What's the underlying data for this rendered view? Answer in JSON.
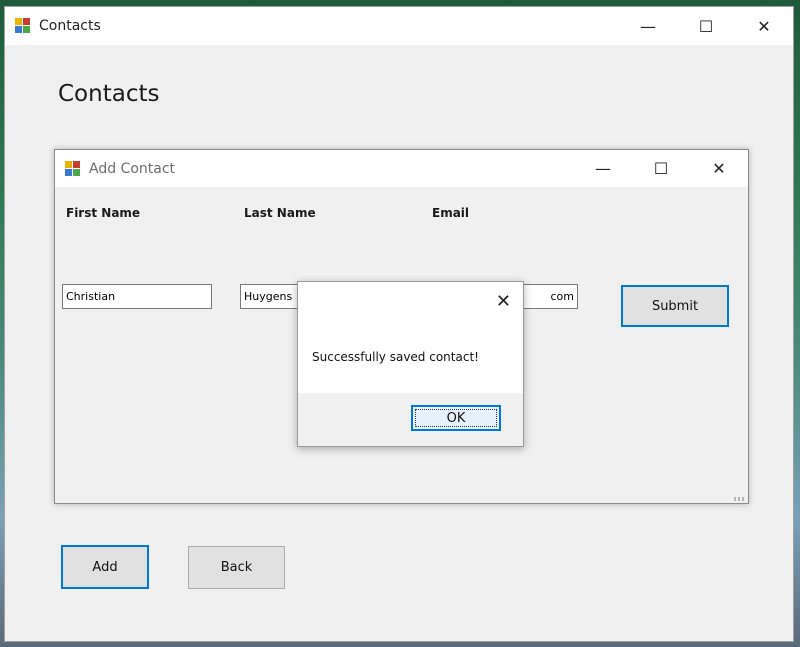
{
  "main": {
    "title": "Contacts",
    "heading": "Contacts",
    "add_label": "Add",
    "back_label": "Back"
  },
  "add_contact": {
    "title": "Add Contact",
    "labels": {
      "first_name": "First Name",
      "last_name": "Last Name",
      "email": "Email"
    },
    "values": {
      "first_name": "Christian",
      "last_name": "Huygens",
      "email": "com"
    },
    "submit_label": "Submit"
  },
  "dialog": {
    "message": "Successfully saved contact!",
    "ok_label": "OK"
  },
  "caption": {
    "minimize": "—",
    "maximize": "☐",
    "close": "✕"
  },
  "colors": {
    "accent": "#0078d7",
    "window_bg": "#f0f0f0"
  }
}
